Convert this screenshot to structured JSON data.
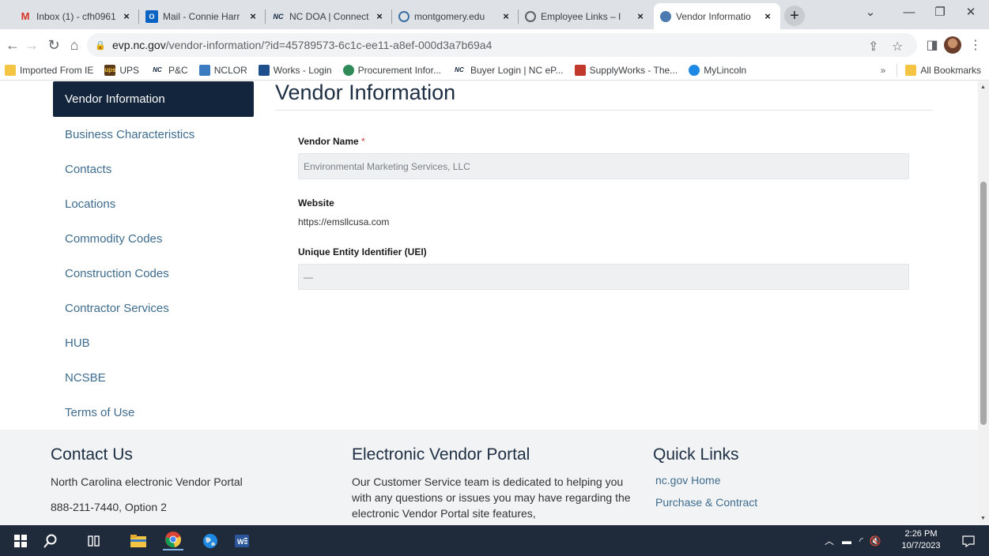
{
  "browser": {
    "tabs": [
      {
        "title": "Inbox (1) - cfh0961",
        "icon": "gmail-icon",
        "color": "#d93025"
      },
      {
        "title": "Mail - Connie Harr",
        "icon": "outlook-icon",
        "color": "#0a64c4"
      },
      {
        "title": "NC DOA | Connect",
        "icon": "nc-icon",
        "color": "#12253c"
      },
      {
        "title": "montgomery.edu",
        "icon": "montgomery-icon",
        "color": "#3b6ea5"
      },
      {
        "title": "Employee Links – I",
        "icon": "globe-icon",
        "color": "#5f6368"
      },
      {
        "title": "Vendor Informatio",
        "icon": "nc-seal-icon",
        "color": "#4a7ab0"
      }
    ],
    "url_host": "evp.nc.gov",
    "url_path": "/vendor-information/?id=45789573-6c1c-ee11-a8ef-000d3a7b69a4",
    "bookmarks": [
      {
        "label": "Imported From IE",
        "icon": "folder-icon",
        "color": "#f4c542"
      },
      {
        "label": "UPS",
        "icon": "ups-icon",
        "color": "#5b3a1a"
      },
      {
        "label": "P&C",
        "icon": "nc-icon",
        "color": "#12253c"
      },
      {
        "label": "NCLOR",
        "icon": "nclor-icon",
        "color": "#3b7bbf"
      },
      {
        "label": "Works - Login",
        "icon": "works-icon",
        "color": "#1f4e8c"
      },
      {
        "label": "Procurement Infor...",
        "icon": "procurement-icon",
        "color": "#2e8b57"
      },
      {
        "label": "Buyer Login | NC eP...",
        "icon": "nc-icon",
        "color": "#12253c"
      },
      {
        "label": "SupplyWorks - The...",
        "icon": "supplyworks-icon",
        "color": "#c0392b"
      },
      {
        "label": "MyLincoln",
        "icon": "cloud-icon",
        "color": "#1e88e5"
      }
    ],
    "overflow_label": "»",
    "all_bookmarks_label": "All Bookmarks"
  },
  "sidenav": {
    "items": [
      "Vendor Information",
      "Business Characteristics",
      "Contacts",
      "Locations",
      "Commodity Codes",
      "Construction Codes",
      "Contractor Services",
      "HUB",
      "NCSBE",
      "Terms of Use"
    ],
    "active_index": 0
  },
  "main": {
    "title": "Vendor Information",
    "vendor_name_label": "Vendor Name",
    "required_mark": "*",
    "vendor_name_value": "Environmental Marketing Services, LLC",
    "website_label": "Website",
    "website_value": "https://emsllcusa.com",
    "uei_label": "Unique Entity Identifier (UEI)",
    "uei_value": "—"
  },
  "footer": {
    "contact_title": "Contact Us",
    "contact_line1": "North Carolina electronic Vendor Portal",
    "contact_line2": "888-211-7440, Option 2",
    "portal_title": "Electronic Vendor Portal",
    "portal_text": "Our Customer Service team is dedicated to helping you with any questions or issues you may have regarding the electronic Vendor Portal site features,",
    "links_title": "Quick Links",
    "links": [
      "nc.gov Home",
      "Purchase & Contract"
    ]
  },
  "taskbar": {
    "time": "2:26 PM",
    "date": "10/7/2023"
  },
  "colors": {
    "nav_active_bg": "#12253c",
    "link": "#3e6c8e",
    "required": "#d23c3c"
  }
}
